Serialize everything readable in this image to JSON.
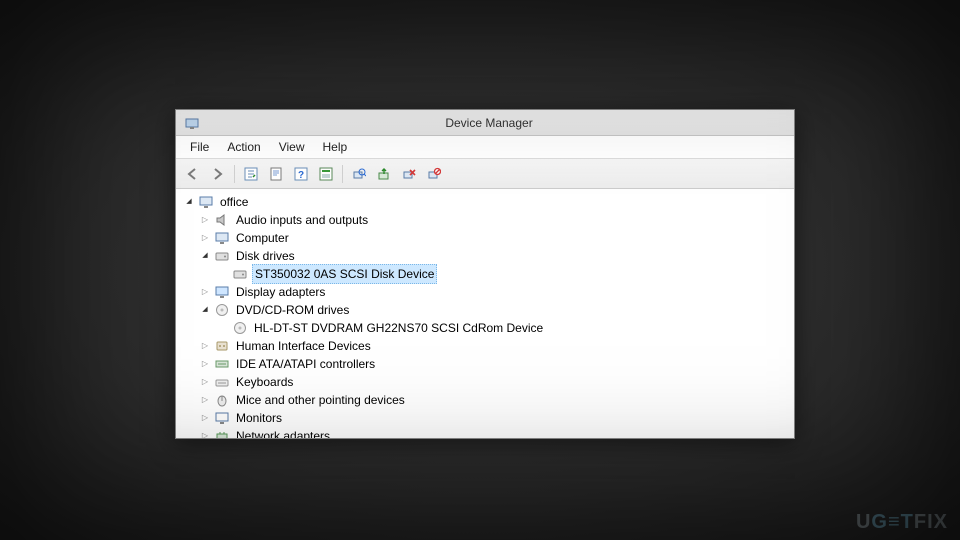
{
  "window": {
    "title": "Device Manager"
  },
  "menu": {
    "file": "File",
    "action": "Action",
    "view": "View",
    "help": "Help"
  },
  "toolbar_icons": {
    "back": "back-arrow-icon",
    "fwd": "forward-arrow-icon",
    "showhide": "showhide-tree-icon",
    "properties": "properties-icon",
    "help": "help-icon",
    "events": "events-icon",
    "scan": "scan-hardware-icon",
    "update": "update-driver-icon",
    "uninstall": "uninstall-icon",
    "disable": "disable-device-icon"
  },
  "tree": {
    "root": "office",
    "items": [
      {
        "label": "Audio inputs and outputs",
        "icon": "speaker-icon",
        "expanded": false
      },
      {
        "label": "Computer",
        "icon": "computer-icon",
        "expanded": false
      },
      {
        "label": "Disk drives",
        "icon": "disk-icon",
        "expanded": true,
        "children": [
          {
            "label": "ST350032 0AS SCSI Disk Device",
            "icon": "disk-icon",
            "selected": true
          }
        ]
      },
      {
        "label": "Display adapters",
        "icon": "display-icon",
        "expanded": false
      },
      {
        "label": "DVD/CD-ROM drives",
        "icon": "dvd-icon",
        "expanded": true,
        "children": [
          {
            "label": "HL-DT-ST DVDRAM GH22NS70 SCSI CdRom Device",
            "icon": "dvd-icon"
          }
        ]
      },
      {
        "label": "Human Interface Devices",
        "icon": "hid-icon",
        "expanded": false
      },
      {
        "label": "IDE ATA/ATAPI controllers",
        "icon": "ide-icon",
        "expanded": false
      },
      {
        "label": "Keyboards",
        "icon": "keyboard-icon",
        "expanded": false
      },
      {
        "label": "Mice and other pointing devices",
        "icon": "mouse-icon",
        "expanded": false
      },
      {
        "label": "Monitors",
        "icon": "monitor-icon",
        "expanded": false
      },
      {
        "label": "Network adapters",
        "icon": "network-icon",
        "expanded": false
      }
    ]
  },
  "watermark": {
    "text": "UG≡TFIX"
  }
}
